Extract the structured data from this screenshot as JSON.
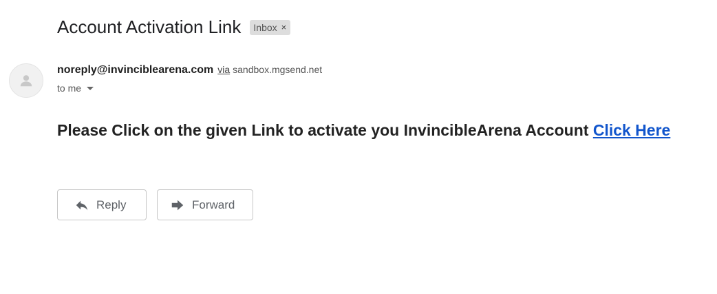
{
  "email": {
    "subject": "Account Activation Link",
    "label": "Inbox",
    "label_close": "×",
    "sender": "noreply@invinciblearena.com",
    "via_label": "via",
    "via_domain": "sandbox.mgsend.net",
    "recipient": "to me",
    "body_text": "Please Click on the given Link to activate you InvincibleArena Account",
    "body_link": "Click Here"
  },
  "actions": {
    "reply_label": "Reply",
    "forward_label": "Forward"
  },
  "icons": {
    "avatar": "person-icon",
    "reply": "reply-arrow-icon",
    "forward": "forward-arrow-icon",
    "recipient_dropdown": "caret-down-icon"
  },
  "colors": {
    "link": "#1155cc",
    "label_chip_bg": "#dddddd"
  }
}
